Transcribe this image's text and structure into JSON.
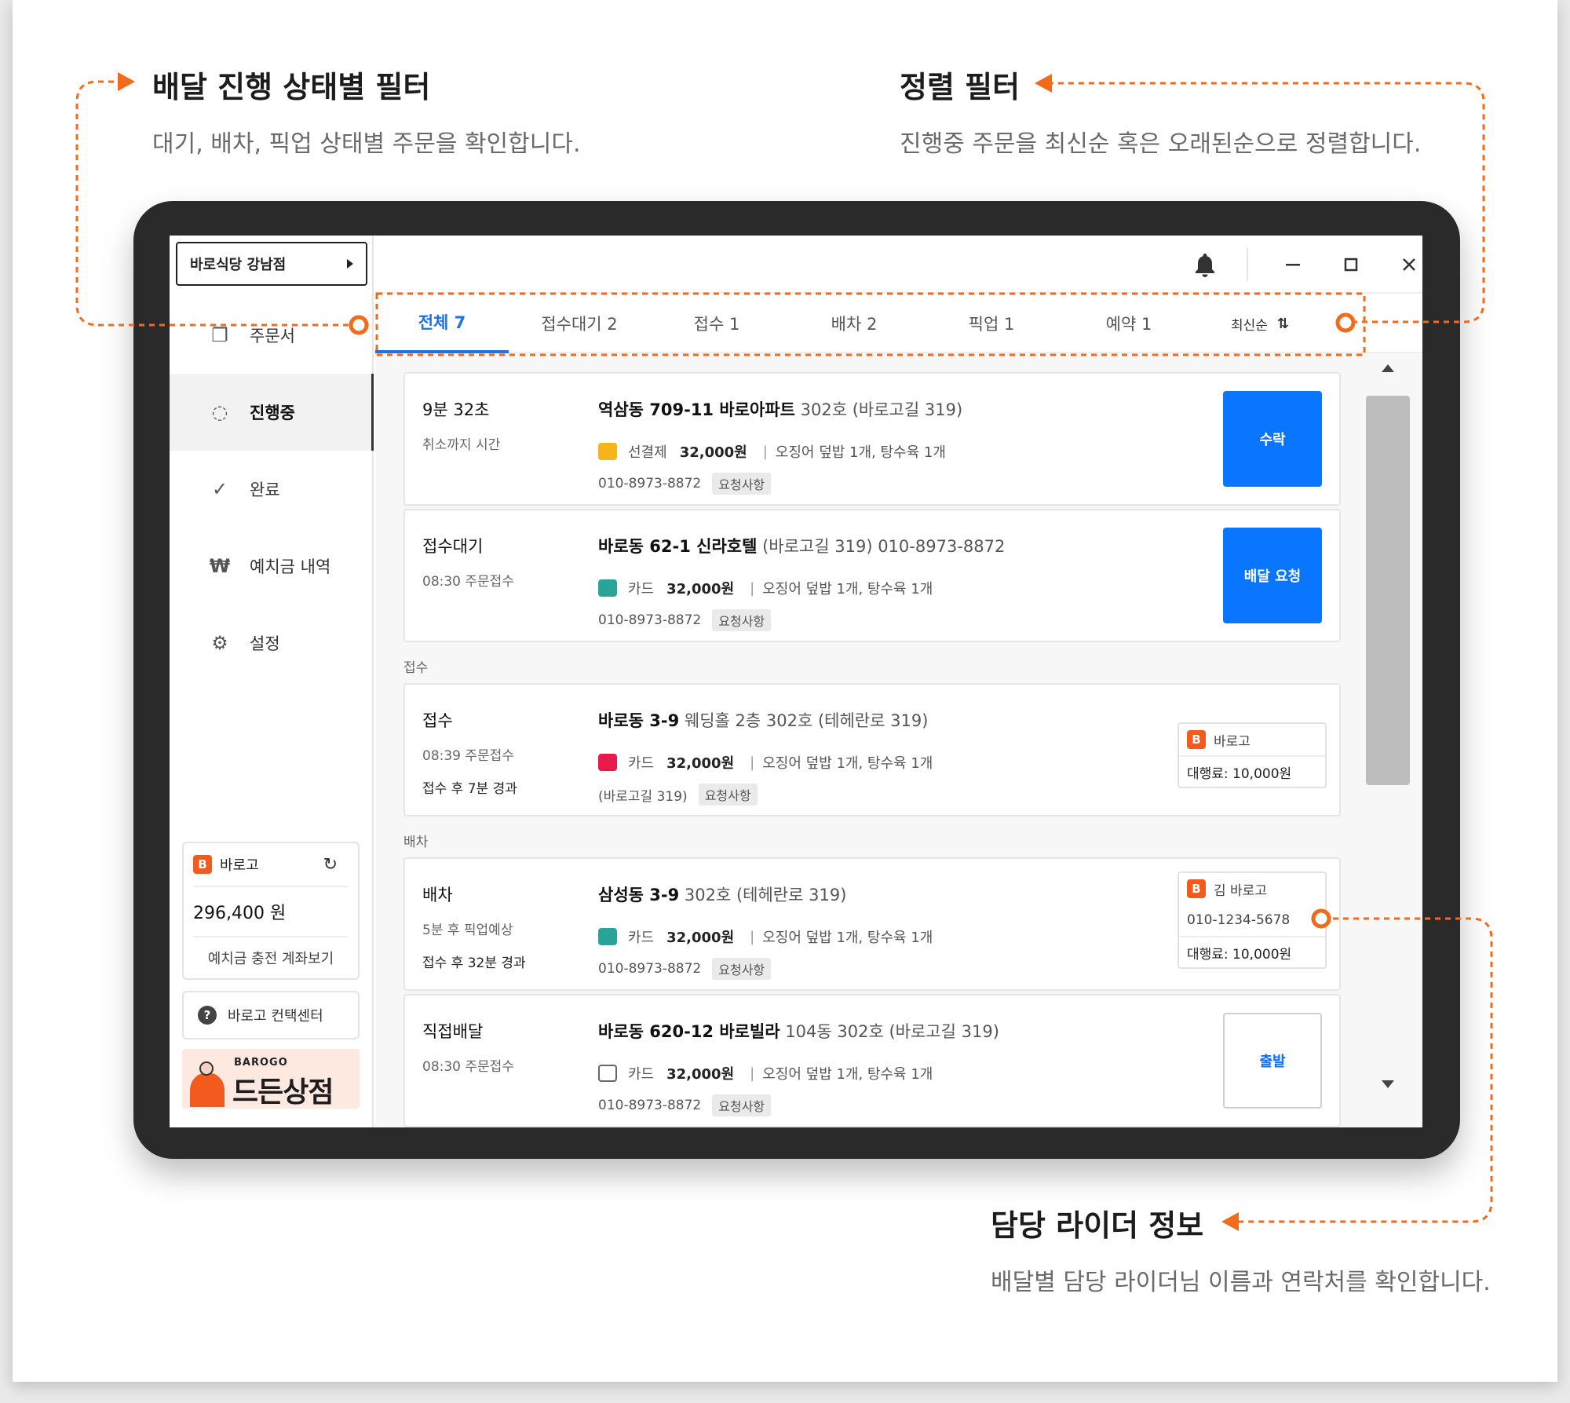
{
  "annotations": {
    "filter_title": "배달 진행 상태별 필터",
    "filter_desc": "대기, 배차, 픽업 상태별 주문을 확인합니다.",
    "sort_title": "정렬 필터",
    "sort_desc": "진행중 주문을 최신순 혹은 오래된순으로 정렬합니다.",
    "rider_title": "담당 라이더 정보",
    "rider_desc": "배달별 담당 라이더님 이름과 연락처를 확인합니다."
  },
  "colors": {
    "accent": "#f25b1d",
    "primary": "#0a75ff"
  },
  "sidebar": {
    "store": "바로식당 강남점",
    "items": [
      {
        "label": "주문서",
        "icon": "copy-icon"
      },
      {
        "label": "진행중",
        "icon": "progress-icon"
      },
      {
        "label": "완료",
        "icon": "check-icon"
      },
      {
        "label": "예치금 내역",
        "icon": "won-icon"
      },
      {
        "label": "설정",
        "icon": "gear-icon"
      }
    ],
    "wallet": {
      "name": "바로고",
      "amount": "296,400 원",
      "link": "예치금 충전 계좌보기"
    },
    "contact": "바로고 컨택센터",
    "banner": {
      "brand_small": "BAROGO",
      "brand_large": "드든상점"
    }
  },
  "tabs": [
    {
      "label": "전체 7"
    },
    {
      "label": "접수대기 2"
    },
    {
      "label": "접수 1"
    },
    {
      "label": "배차 2"
    },
    {
      "label": "픽업 1"
    },
    {
      "label": "예약 1"
    }
  ],
  "sort": {
    "label": "최신순",
    "icon": "sort-icon"
  },
  "sections": {
    "accept": "접수",
    "dispatch": "배차"
  },
  "orders": [
    {
      "status": "9분 32초",
      "sub": "취소까지 시간",
      "sub2": "",
      "addr_main": "역삼동 709-11 바로아파트",
      "addr_rest": " 302호  (바로고길 319)",
      "pay_method": "선결제",
      "amount": "32,000원",
      "items": "오징어 덮밥 1개, 탕수육 1개",
      "phone": "010-8973-8872",
      "tag": "요청사항",
      "action": "수락",
      "pm_color": "#f4b41a"
    },
    {
      "status": "접수대기",
      "sub": "08:30 주문접수",
      "sub2": "",
      "addr_main": "바로동 62-1 신라호텔",
      "addr_rest": " (바로고길 319)  010-8973-8872",
      "pay_method": "카드",
      "amount": "32,000원",
      "items": "오징어 덮밥 1개, 탕수육 1개",
      "phone": "010-8973-8872",
      "tag": "요청사항",
      "action": "배달 요청",
      "pm_color": "#2aa39a"
    },
    {
      "status": "접수",
      "sub": "08:39 주문접수",
      "sub2": "접수 후 7분 경과",
      "addr_main": "바로동 3-9",
      "addr_rest": " 웨딩홀 2층 302호  (테헤란로 319)",
      "pay_method": "카드",
      "amount": "32,000원",
      "items": "오징어 덮밥 1개, 탕수육 1개",
      "phone": "(바로고길 319)",
      "tag": "요청사항",
      "rider": {
        "name": "바로고",
        "fee": "대행료: 10,000원"
      },
      "pm_color": "#e8194c"
    },
    {
      "status": "배차",
      "sub": "5분 후 픽업예상",
      "sub2": "접수 후 32분 경과",
      "addr_main": "삼성동 3-9",
      "addr_rest": " 302호  (테헤란로 319)",
      "pay_method": "카드",
      "amount": "32,000원",
      "items": "오징어 덮밥 1개, 탕수육 1개",
      "phone": "010-8973-8872",
      "tag": "요청사항",
      "rider": {
        "name": "김 바로고",
        "phone": "010-1234-5678",
        "fee": "대행료: 10,000원"
      },
      "pm_color": "#2aa39a"
    },
    {
      "status": "직접배달",
      "sub": "08:30 주문접수",
      "sub2": "",
      "addr_main": "바로동 620-12 바로빌라",
      "addr_rest": " 104동 302호  (바로고길 319)",
      "pay_method": "카드",
      "amount": "32,000원",
      "items": "오징어 덮밥 1개, 탕수육 1개",
      "phone": "010-8973-8872",
      "tag": "요청사항",
      "action": "출발",
      "pm_color": "#ffffff"
    }
  ]
}
